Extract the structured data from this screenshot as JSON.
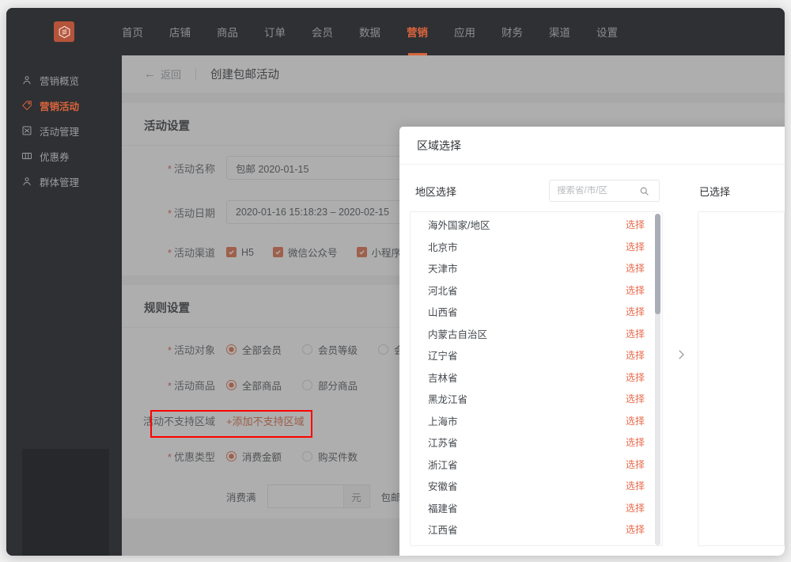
{
  "app": {
    "logo_icon": "hexagon-logo-icon",
    "accent_color": "#d9643c",
    "topnav": [
      {
        "label": "首页",
        "active": false
      },
      {
        "label": "店铺",
        "active": false
      },
      {
        "label": "商品",
        "active": false
      },
      {
        "label": "订单",
        "active": false
      },
      {
        "label": "会员",
        "active": false
      },
      {
        "label": "数据",
        "active": false
      },
      {
        "label": "营销",
        "active": true
      },
      {
        "label": "应用",
        "active": false
      },
      {
        "label": "财务",
        "active": false
      },
      {
        "label": "渠道",
        "active": false
      },
      {
        "label": "设置",
        "active": false
      }
    ]
  },
  "sidebar": {
    "items": [
      {
        "label": "营销概览",
        "icon": "person-icon",
        "active": false
      },
      {
        "label": "营销活动",
        "icon": "tag-icon",
        "active": true
      },
      {
        "label": "活动管理",
        "icon": "grid-box-icon",
        "active": false
      },
      {
        "label": "优惠券",
        "icon": "coupon-icon",
        "active": false
      },
      {
        "label": "群体管理",
        "icon": "person-icon",
        "active": false
      }
    ]
  },
  "breadcrumb": {
    "back_label": "返回",
    "back_icon": "arrow-left-icon",
    "title": "创建包邮活动"
  },
  "activity_settings": {
    "title": "活动设置",
    "name_label": "活动名称",
    "name_value": "包邮  2020-01-15",
    "date_label": "活动日期",
    "date_value": "2020-01-16 15:18:23 – 2020-02-15",
    "channel_label": "活动渠道",
    "channels": [
      {
        "label": "H5",
        "checked": true
      },
      {
        "label": "微信公众号",
        "checked": true
      },
      {
        "label": "小程序",
        "checked": true
      }
    ]
  },
  "rule_settings": {
    "title": "规则设置",
    "target_label": "活动对象",
    "target_options": [
      {
        "label": "全部会员",
        "selected": true
      },
      {
        "label": "会员等级",
        "selected": false
      },
      {
        "label": "会",
        "selected": false
      }
    ],
    "goods_label": "活动商品",
    "goods_options": [
      {
        "label": "全部商品",
        "selected": true
      },
      {
        "label": "部分商品",
        "selected": false
      }
    ],
    "region_label": "活动不支持区域",
    "region_add_link": "+添加不支持区域",
    "discount_label": "优惠类型",
    "discount_options": [
      {
        "label": "消费金额",
        "selected": true
      },
      {
        "label": "购买件数",
        "selected": false
      }
    ],
    "amount_prefix": "消费满",
    "amount_value": "",
    "amount_unit": "元",
    "amount_suffix": "包邮"
  },
  "modal": {
    "title": "区域选择",
    "left_label": "地区选择",
    "search_placeholder": "搜索省/市/区",
    "search_value": "",
    "search_icon": "search-icon",
    "transfer_icon": "chevron-right-icon",
    "selected_label": "已选择",
    "selected_items": [],
    "pick_label": "选择",
    "regions": [
      "海外国家/地区",
      "北京市",
      "天津市",
      "河北省",
      "山西省",
      "内蒙古自治区",
      "辽宁省",
      "吉林省",
      "黑龙江省",
      "上海市",
      "江苏省",
      "浙江省",
      "安徽省",
      "福建省",
      "江西省"
    ]
  },
  "annotations": {
    "highlight_color": "#ff0000",
    "boxes": [
      "活动不支持区域 row",
      "地区选择 label"
    ]
  }
}
